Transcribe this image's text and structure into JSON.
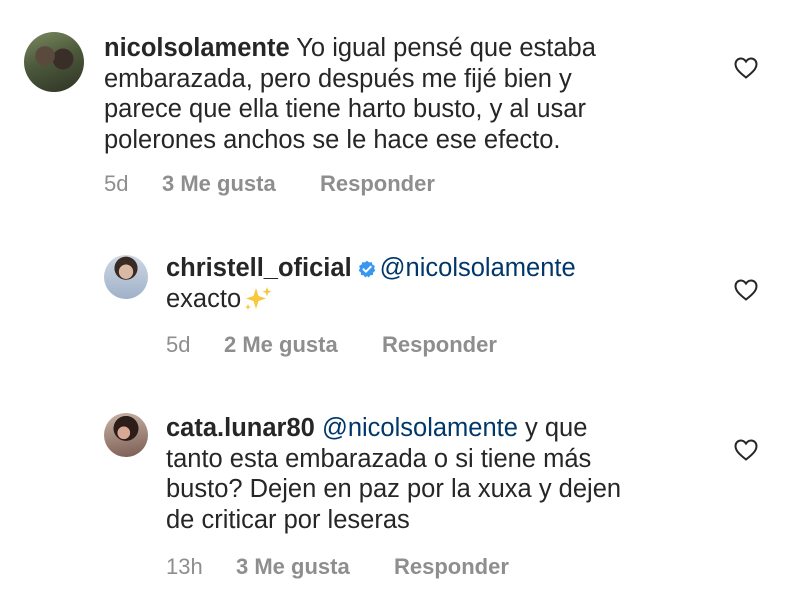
{
  "comments": [
    {
      "username": "nicolsolamente",
      "lines": [
        "Yo igual pensé que estaba",
        "embarazada, pero después me fijé bien y",
        "parece que ella tiene harto busto, y al usar",
        "polerones anchos se le hace ese efecto."
      ],
      "time": "5d",
      "likes": "3 Me gusta",
      "reply": "Responder"
    },
    {
      "username": "christell_oficial",
      "verified": true,
      "mention": "@nicolsolamente",
      "text": "exacto",
      "emoji": "sparkles",
      "time": "5d",
      "likes": "2 Me gusta",
      "reply": "Responder"
    },
    {
      "username": "cata.lunar80",
      "mention": "@nicolsolamente",
      "first_line_rest": "y que",
      "lines": [
        "tanto esta embarazada o si tiene más",
        "busto? Dejen en paz por la xuxa y dejen",
        "de criticar por leseras"
      ],
      "time": "13h",
      "likes": "3 Me gusta",
      "reply": "Responder"
    }
  ],
  "colors": {
    "text": "#262626",
    "secondary": "#8e8e8e",
    "mention": "#00376b",
    "verified": "#3897f0"
  },
  "icons": {
    "like": "heart-outline-icon",
    "verified": "verified-badge-icon",
    "emoji": "sparkles-icon"
  }
}
